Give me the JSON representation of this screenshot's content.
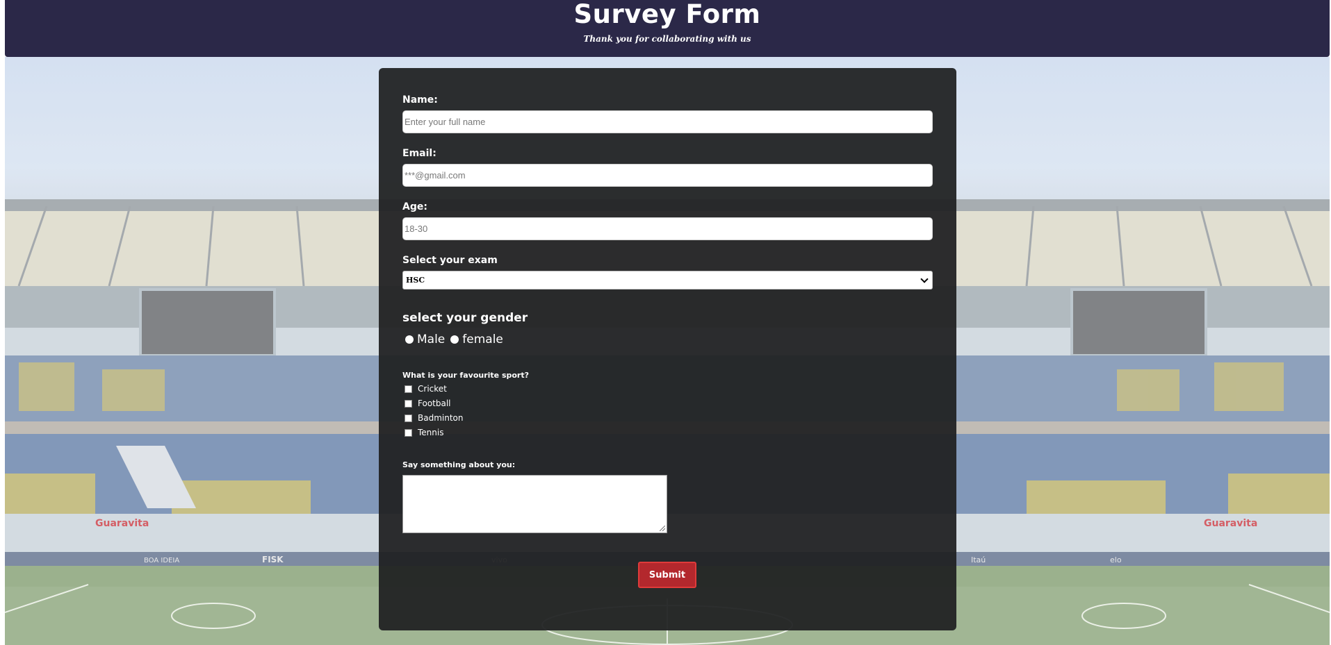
{
  "header": {
    "title": "Survey Form",
    "subtitle": "Thank you for collaborating with us"
  },
  "form": {
    "name": {
      "label": "Name:",
      "placeholder": "Enter your full name"
    },
    "email": {
      "label": "Email:",
      "placeholder": "***@gmail.com"
    },
    "age": {
      "label": "Age:",
      "placeholder": "18-30"
    },
    "exam": {
      "label": "Select your exam",
      "selected": "HSC"
    },
    "gender": {
      "label": "select your gender",
      "options": [
        "Male",
        "female"
      ]
    },
    "sport": {
      "label": "What is your favourite sport?",
      "options": [
        "Cricket",
        "Football",
        "Badminton",
        "Tennis"
      ]
    },
    "about": {
      "label": "Say something about you:"
    },
    "submit_label": "Submit"
  },
  "background": {
    "ad_boards": [
      "Guaravita",
      "FISK",
      "BOA IDEIA",
      "vivo",
      "Itaú",
      "elo",
      "Guaravita"
    ]
  },
  "colors": {
    "header_bg": "#2b2848",
    "card_bg": "#202122",
    "submit_bg": "#b3282d",
    "seat_blue": "#5a78a8",
    "seat_yellow": "#c8b24a",
    "pitch": "#7e9a6a"
  }
}
